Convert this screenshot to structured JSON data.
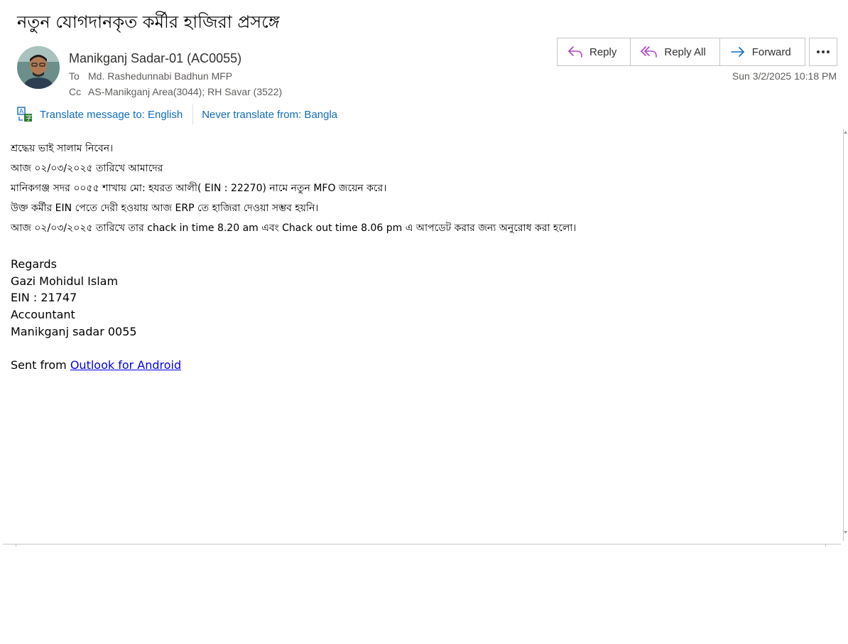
{
  "subject": "নতুন যোগদানকৃত কর্মীর হাজিরা প্রসঙ্গে",
  "sender": {
    "name": "Manikganj Sadar-01 (AC0055)",
    "to_label": "To",
    "to": "Md. Rashedunnabi Badhun MFP",
    "cc_label": "Cc",
    "cc": "AS-Manikganj Area(3044); RH Savar (3522)"
  },
  "actions": {
    "reply": "Reply",
    "reply_all": "Reply All",
    "forward": "Forward"
  },
  "datetime": "Sun 3/2/2025 10:18 PM",
  "translate": {
    "translate_to": "Translate message to: English",
    "never_translate": "Never translate from: Bangla"
  },
  "body": {
    "lines": [
      "শ্রদ্ধেয় ভাই সালাম নিবেন।",
      "আজ ০২/০৩/২০২৫ তারিখে আমাদের",
      "মানিকগঞ্জ সদর ০০৫৫ শাখায় মো: হযরত আলী( EIN : 22270) নামে নতুন MFO জয়েন করে।",
      "উক্ত কর্মীর EIN পেতে দেরী হওয়ায় আজ ERP তে হাজিরা দেওয়া সম্ভব হয়নি।",
      "আজ ০২/০৩/২০২৫ তারিখে তার chack in time 8.20 am এবং Chack out time 8.06 pm এ আপডেট করার জন্য অনুরোধ করা হলো।"
    ]
  },
  "signature": {
    "regards": "Regards",
    "name": "Gazi Mohidul Islam",
    "ein": "EIN : 21747",
    "title": "Accountant",
    "branch": "Manikganj sadar 0055",
    "sent_from": "Sent from ",
    "sent_link": "Outlook for Android"
  },
  "colors": {
    "accent": "#0f6cbd",
    "reply_icon": "#b146c2",
    "forward_icon": "#0f6cbd"
  }
}
